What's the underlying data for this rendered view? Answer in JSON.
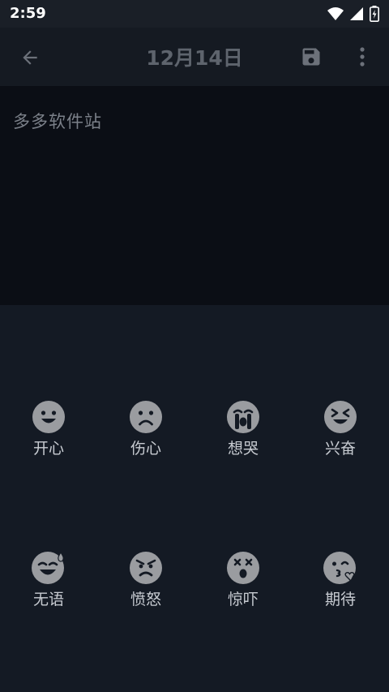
{
  "status": {
    "time": "2:59"
  },
  "header": {
    "title": "12月14日"
  },
  "editor": {
    "content": "多多软件站"
  },
  "moods": [
    {
      "label": "开心",
      "icon": "happy-face-icon"
    },
    {
      "label": "伤心",
      "icon": "sad-face-icon"
    },
    {
      "label": "想哭",
      "icon": "crying-face-icon"
    },
    {
      "label": "兴奋",
      "icon": "excited-face-icon"
    },
    {
      "label": "无语",
      "icon": "sweat-smile-face-icon"
    },
    {
      "label": "愤怒",
      "icon": "angry-face-icon"
    },
    {
      "label": "惊吓",
      "icon": "shocked-face-icon"
    },
    {
      "label": "期待",
      "icon": "kiss-face-icon"
    }
  ],
  "colors": {
    "background": "#131924",
    "editor": "#0b0e15",
    "face": "#9a9ca0"
  }
}
